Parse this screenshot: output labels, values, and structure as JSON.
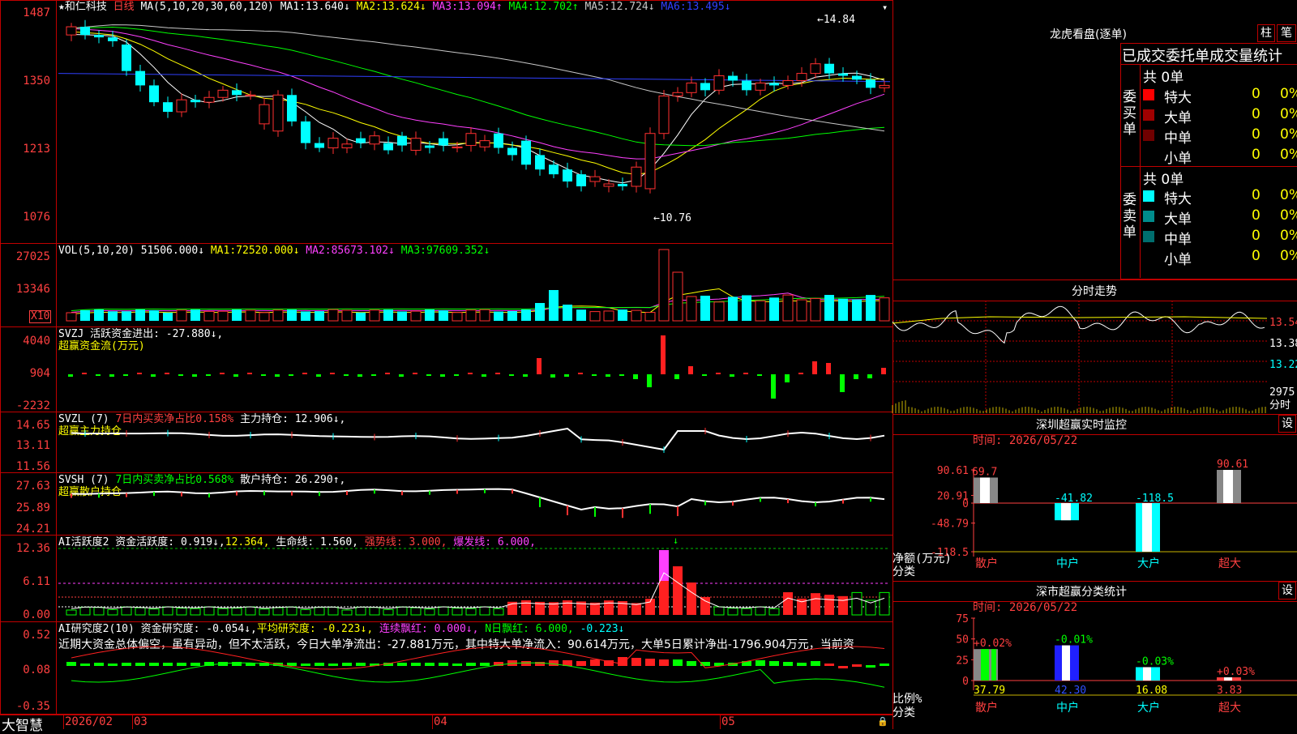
{
  "stock": {
    "title": "和仁科技",
    "period": "日线",
    "ma_params": "MA(5,10,20,30,60,120)",
    "ma": [
      {
        "label": "MA1:",
        "value": "13.640↓",
        "color": "#ffffff"
      },
      {
        "label": "MA2:",
        "value": "13.624↓",
        "color": "#ffff00"
      },
      {
        "label": "MA3:",
        "value": "13.094↑",
        "color": "#ff40ff"
      },
      {
        "label": "MA4:",
        "value": "12.702↑",
        "color": "#00ff00"
      },
      {
        "label": "MA5:",
        "value": "12.724↓",
        "color": "#c8c8c8"
      },
      {
        "label": "MA6:",
        "value": "13.495↓",
        "color": "#3040ff"
      }
    ],
    "price_axis": [
      "1487",
      "1350",
      "1213",
      "1076"
    ],
    "high_label": "14.84",
    "low_label": "10.76"
  },
  "vol": {
    "header": "VOL(5,10,20)",
    "value": "51506.000↓",
    "ma": [
      {
        "label": "MA1:",
        "value": "72520.000↓",
        "color": "#ffff00"
      },
      {
        "label": "MA2:",
        "value": "85673.102↓",
        "color": "#ff40ff"
      },
      {
        "label": "MA3:",
        "value": "97609.352↓",
        "color": "#00ff00"
      }
    ],
    "axis": [
      "27025",
      "13346"
    ],
    "unit": "X10"
  },
  "svzj": {
    "header": "SVZJ  活跃资金进出: -27.880↓,",
    "sub": "超赢资金流(万元)",
    "axis": [
      "4040",
      "904",
      "-2232"
    ]
  },
  "svzl": {
    "header": "SVZL (7)",
    "ratio": "7日内买卖净占比0.158%",
    "hold": "主力持仓: 12.906↓,",
    "sub": "超赢主力持仓",
    "axis": [
      "14.65",
      "13.11",
      "11.56"
    ]
  },
  "svsh": {
    "header": "SVSH (7)",
    "ratio": "7日内买卖净占比0.568%",
    "hold": "散户持仓: 26.290↑,",
    "sub": "超赢散户持仓",
    "axis": [
      "27.63",
      "25.89",
      "24.21"
    ]
  },
  "ai_active": {
    "header": "AI活跃度2 资金活跃度: 0.919↓,",
    "v2": "12.364,",
    "v3": "生命线: 1.560,",
    "strong": "强势线: 3.000,",
    "burst": "爆发线: 6.000,",
    "axis": [
      "12.36",
      "6.11",
      "0.00"
    ]
  },
  "ai_research": {
    "header": "AI研究度2(10) 资金研究度: -0.054↓,",
    "avg": "平均研究度: -0.223↓,",
    "lian": "连续飘红: 0.000↓,",
    "nday": "N日飘红: 6.000,",
    "last": "-0.223↓",
    "note": "近期大资金总体偏空，虽有异动，但不太活跃，今日大单净流出：-27.881万元，其中特大单净流入：90.614万元，大单5日累计净出-1796.904万元，当前资",
    "axis": [
      "0.52",
      "0.08",
      "-0.35"
    ]
  },
  "dates": {
    "d1": "2026/02",
    "d2": "03",
    "d3": "04",
    "d4": "05"
  },
  "brand": "大智慧",
  "dragon": {
    "title": "龙虎看盘(逐单)",
    "btn1": "柱",
    "btn2": "笔",
    "tab_header": "已成交委托单成交量统计",
    "buy_label": "委买单",
    "sell_label": "委卖单",
    "buy_total": "共 0单",
    "sell_total": "共 0单",
    "buy_rows": [
      {
        "name": "特大",
        "count": "0",
        "pct": "0%",
        "color": "#ff0000"
      },
      {
        "name": "大单",
        "count": "0",
        "pct": "0%",
        "color": "#a00000"
      },
      {
        "name": "中单",
        "count": "0",
        "pct": "0%",
        "color": "#700000"
      },
      {
        "name": "小单",
        "count": "0",
        "pct": "0%",
        "color": ""
      }
    ],
    "sell_rows": [
      {
        "name": "特大",
        "count": "0",
        "pct": "0%",
        "color": "#00ffff"
      },
      {
        "name": "大单",
        "count": "0",
        "pct": "0%",
        "color": "#008c8c"
      },
      {
        "name": "中单",
        "count": "0",
        "pct": "0%",
        "color": "#006e6e"
      },
      {
        "name": "小单",
        "count": "0",
        "pct": "0%",
        "color": ""
      }
    ]
  },
  "intraday": {
    "title": "分时走势",
    "axis": [
      "13.54",
      "13.38",
      "13.22",
      "2975"
    ],
    "unit": "分时"
  },
  "sz_monitor": {
    "title": "深圳超赢实时监控",
    "btn": "设",
    "time": "时间: 2026/05/22",
    "axis": [
      "90.61",
      "20.91",
      "0",
      "-48.79",
      "-118.5"
    ],
    "ylabel": "净额(万元)",
    "xlabel": "分类",
    "categories": [
      "散户",
      "中户",
      "大户",
      "超大"
    ],
    "values": [
      "69.7",
      "-41.82",
      "-118.5",
      "90.61"
    ]
  },
  "sz_class": {
    "title": "深市超赢分类统计",
    "btn": "设",
    "time": "时间: 2026/05/22",
    "axis": [
      "75",
      "50",
      "25",
      "0"
    ],
    "ylabel": "比例%",
    "xlabel": "分类",
    "categories": [
      "散户",
      "中户",
      "大户",
      "超大"
    ],
    "values": [
      "37.79",
      "42.30",
      "16.08",
      "3.83"
    ],
    "changes": [
      "+0.02%",
      "-0.01%",
      "-0.03%",
      "+0.03%"
    ]
  },
  "chart_data": {
    "type": "candlestick",
    "title": "和仁科技 日线",
    "x": [
      "2026/02",
      "03",
      "04",
      "05"
    ],
    "ylim": [
      10.76,
      14.84
    ],
    "open": [
      14.45,
      14.62,
      14.45,
      14.4,
      14.25,
      13.7,
      13.4,
      13.05,
      12.85,
      13.1,
      13.05,
      13.15,
      13.3,
      13.2,
      12.6,
      12.45,
      13.2,
      12.65,
      12.2,
      12.1,
      12.1,
      12.3,
      12.18,
      12.2,
      12.35,
      12.05,
      12.15,
      12.3,
      12.1,
      12.15,
      12.12,
      12.4,
      12.1,
      12.25,
      11.95,
      11.75,
      11.65,
      11.55,
      11.4,
      11.3,
      11.35,
      11.3,
      11.25,
      12.4,
      13.18,
      13.25,
      13.45,
      13.3,
      13.6,
      13.5,
      13.3,
      13.45,
      13.4,
      13.5,
      13.65,
      13.85,
      13.65,
      13.6,
      13.52,
      13.35
    ],
    "close": [
      14.62,
      14.45,
      14.4,
      14.32,
      13.7,
      13.4,
      13.05,
      12.85,
      13.1,
      13.05,
      13.15,
      13.3,
      13.2,
      13.2,
      13.0,
      13.2,
      12.65,
      12.2,
      12.1,
      12.3,
      12.18,
      12.2,
      12.35,
      12.05,
      12.15,
      12.3,
      12.1,
      12.15,
      12.12,
      12.4,
      12.25,
      12.1,
      11.95,
      11.75,
      11.65,
      11.55,
      11.4,
      11.3,
      11.5,
      11.35,
      11.3,
      11.7,
      12.4,
      13.18,
      13.25,
      13.45,
      13.3,
      13.6,
      13.5,
      13.3,
      13.45,
      13.4,
      13.5,
      13.65,
      13.85,
      13.65,
      13.6,
      13.52,
      13.35,
      13.4
    ],
    "ma": {
      "MA1": 13.64,
      "MA2": 13.624,
      "MA3": 13.094,
      "MA4": 12.702,
      "MA5": 12.724,
      "MA6": 13.495
    },
    "volume_ylim": [
      0,
      27025
    ],
    "research_series": [
      0.08,
      0.05,
      0.06,
      0.05,
      0.06,
      0.06,
      0.07,
      0.06,
      0.07,
      0.06,
      0.08,
      0.08,
      0.08,
      0.07,
      0.06,
      0.06,
      0.07,
      0.05,
      0.07,
      0.05,
      0.06,
      0.07,
      0.05,
      0.06,
      0.06,
      0.07,
      0.07,
      0.06,
      0.05,
      0.06,
      0.07,
      0.08,
      0.12,
      0.1,
      0.08,
      0.11,
      0.12,
      0.1,
      0.13,
      0.12,
      0.18,
      0.16,
      0.15,
      0.14,
      0.13,
      0.1,
      0.09,
      0.07,
      0.06,
      0.1,
      0.12,
      0.1,
      0.08,
      0.06,
      0.1,
      0.05,
      -0.02,
      0.04,
      0.02,
      0.05
    ]
  }
}
